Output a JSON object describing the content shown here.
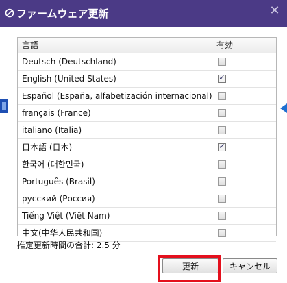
{
  "dialog": {
    "title": "ファームウェア更新",
    "close_glyph": "✕"
  },
  "table": {
    "columns": {
      "language": "言語",
      "enabled": "有効"
    },
    "rows": [
      {
        "language": "Deutsch (Deutschland)",
        "enabled": false
      },
      {
        "language": "English (United States)",
        "enabled": true
      },
      {
        "language": "Español (España, alfabetización internacional)",
        "enabled": false
      },
      {
        "language": "français (France)",
        "enabled": false
      },
      {
        "language": "italiano (Italia)",
        "enabled": false
      },
      {
        "language": "日本語 (日本)",
        "enabled": true
      },
      {
        "language": "한국어 (대한민국)",
        "enabled": false
      },
      {
        "language": "Português (Brasil)",
        "enabled": false
      },
      {
        "language": "русский (Россия)",
        "enabled": false
      },
      {
        "language": "Tiếng Việt (Việt Nam)",
        "enabled": false
      },
      {
        "language": "中文(中华人民共和国)",
        "enabled": false
      }
    ]
  },
  "footer": {
    "total_time": "推定更新時間の合計: 2.5 分",
    "update_label": "更新",
    "cancel_label": "キャンセル"
  },
  "colors": {
    "titlebar": "#4b3a86",
    "highlight": "#e4101d"
  }
}
